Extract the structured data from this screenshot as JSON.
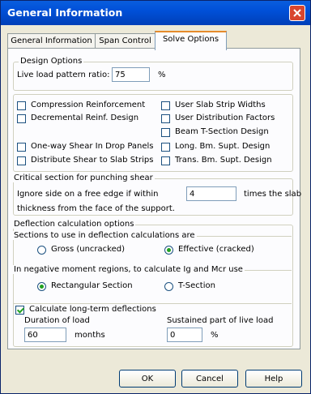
{
  "window": {
    "title": "General Information"
  },
  "tabs": [
    {
      "label": "General Information"
    },
    {
      "label": "Span Control"
    },
    {
      "label": "Solve Options"
    }
  ],
  "design_options": {
    "legend": "Design Options",
    "live_load_label": "Live load pattern ratio:",
    "live_load_value": "75",
    "live_load_unit": "%"
  },
  "checkboxes": {
    "compression_reinforcement": {
      "label": "Compression Reinforcement",
      "checked": false
    },
    "decremental_reinf": {
      "label": "Decremental Reinf. Design",
      "checked": false
    },
    "one_way_shear": {
      "label": "One-way Shear In Drop Panels",
      "checked": false
    },
    "distribute_shear": {
      "label": "Distribute Shear to Slab Strips",
      "checked": false
    },
    "user_slab_strip": {
      "label": "User Slab Strip Widths",
      "checked": false
    },
    "user_distribution": {
      "label": "User Distribution Factors",
      "checked": false
    },
    "beam_t_section": {
      "label": "Beam T-Section Design",
      "checked": false
    },
    "long_bm": {
      "label": "Long. Bm. Supt. Design",
      "checked": false
    },
    "trans_bm": {
      "label": "Trans. Bm. Supt. Design",
      "checked": false
    }
  },
  "critical_section": {
    "legend": "Critical section for punching shear",
    "line1_prefix": "Ignore side on a free edge if within",
    "value": "4",
    "line1_suffix": "times the slab",
    "line2": "thickness from the face of the support."
  },
  "deflection": {
    "legend": "Deflection calculation options",
    "sections_legend": "Sections to use in deflection calculations are",
    "gross_label": "Gross (uncracked)",
    "effective_label": "Effective (cracked)",
    "selected_section": "Effective (cracked)",
    "negative_legend": "In negative moment regions, to calculate Ig and Mcr use",
    "rect_label": "Rectangular Section",
    "tsec_label": "T-Section",
    "selected_negative": "Rectangular Section",
    "long_term_label": "Calculate long-term deflections",
    "long_term_checked": true,
    "duration_label": "Duration of load",
    "duration_value": "60",
    "duration_unit": "months",
    "sustained_label": "Sustained part of live load",
    "sustained_value": "0",
    "sustained_unit": "%"
  },
  "buttons": {
    "ok": "OK",
    "cancel": "Cancel",
    "help": "Help"
  },
  "colors": {
    "titlebar": "#0054e3",
    "face": "#ece9d8",
    "check": "#21a121",
    "close": "#d8462f"
  }
}
